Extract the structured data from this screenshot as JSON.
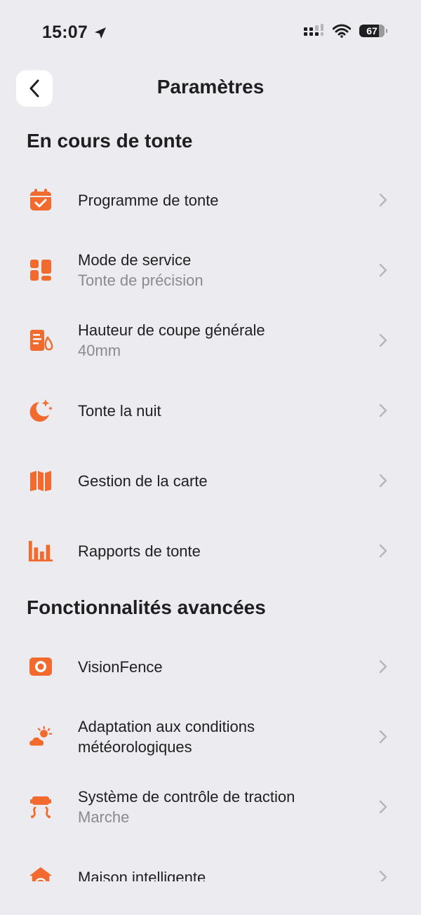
{
  "status_bar": {
    "time": "15:07",
    "battery": "67"
  },
  "header": {
    "title": "Paramètres"
  },
  "sections": [
    {
      "title": "En cours de tonte",
      "items": [
        {
          "label": "Programme de tonte",
          "sub": "",
          "icon": "calendar-check-icon"
        },
        {
          "label": "Mode de service",
          "sub": "Tonte de précision",
          "icon": "layout-blocks-icon"
        },
        {
          "label": "Hauteur de coupe générale",
          "sub": "40mm",
          "icon": "cut-height-icon"
        },
        {
          "label": "Tonte la nuit",
          "sub": "",
          "icon": "moon-stars-icon"
        },
        {
          "label": "Gestion de la carte",
          "sub": "",
          "icon": "map-icon"
        },
        {
          "label": "Rapports de tonte",
          "sub": "",
          "icon": "bar-chart-icon"
        }
      ]
    },
    {
      "title": "Fonctionnalités avancées",
      "items": [
        {
          "label": "VisionFence",
          "sub": "",
          "icon": "camera-eye-icon"
        },
        {
          "label": "Adaptation aux conditions météorologiques",
          "sub": "",
          "icon": "weather-icon"
        },
        {
          "label": "Système de contrôle de traction",
          "sub": "Marche",
          "icon": "traction-icon"
        },
        {
          "label": "Maison intelligente",
          "sub": "",
          "icon": "smart-home-icon"
        }
      ]
    }
  ],
  "colors": {
    "accent": "#F26A2E",
    "background": "#ECECF0",
    "text": "#1F1F22",
    "secondary_text": "#8A8A8F",
    "chevron": "#B5B5BA"
  }
}
